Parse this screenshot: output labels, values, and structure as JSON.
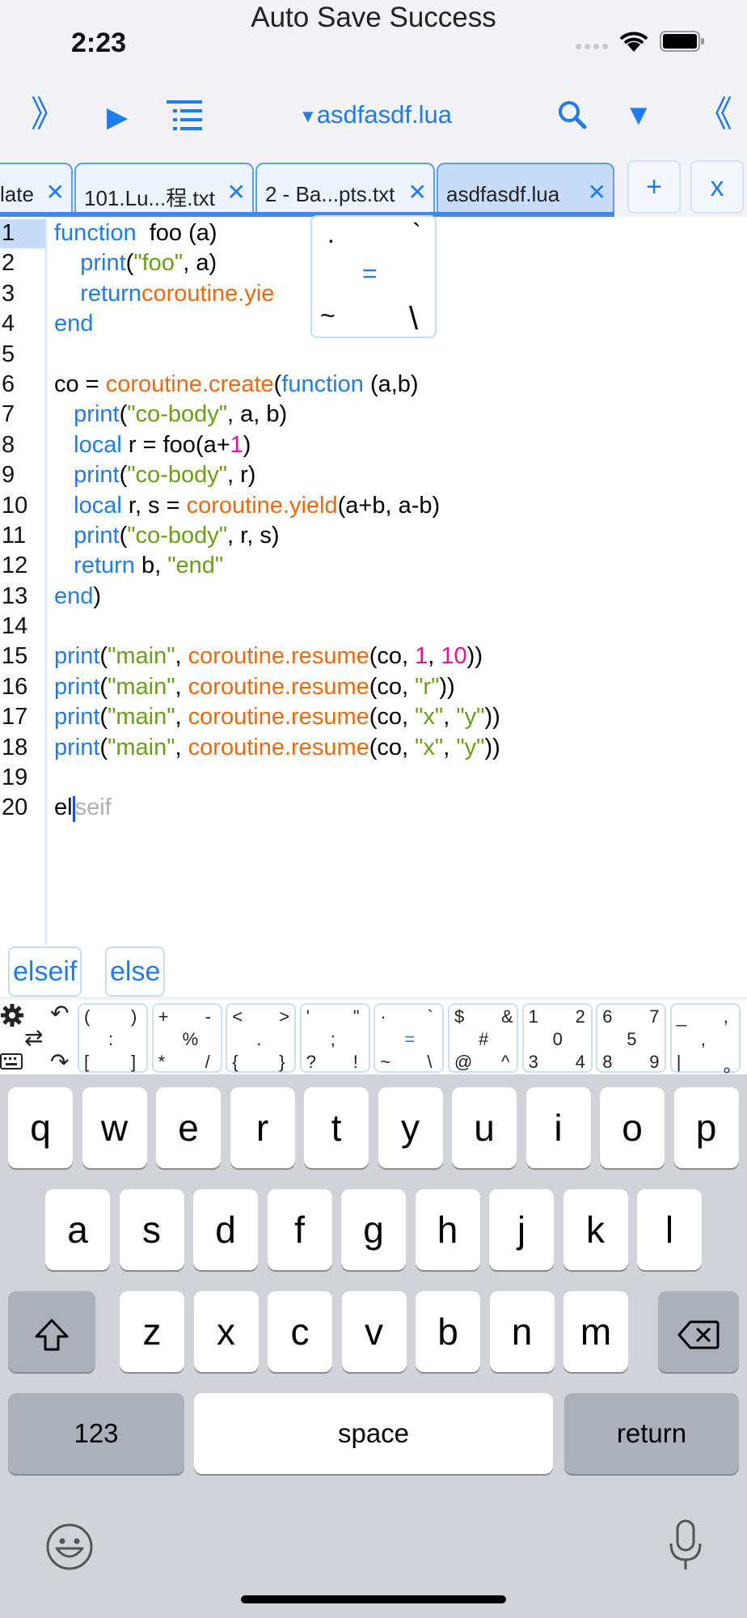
{
  "status": {
    "notice": "Auto Save Success",
    "time": "2:23"
  },
  "toolbar": {
    "left_expand": "》",
    "run": "▶",
    "list_icon": "list-icon",
    "file_title": "asdfasdf.lua",
    "search_icon": "search-icon",
    "filter": "▼",
    "right_collapse": "《"
  },
  "tabs": [
    {
      "label": "late",
      "close": "✕"
    },
    {
      "label": "101.Lu...程.txt",
      "close": "✕"
    },
    {
      "label": "2 - Ba...pts.txt",
      "close": "✕"
    },
    {
      "label": "asdfasdf.lua",
      "close": "✕",
      "active": true
    }
  ],
  "tab_actions": {
    "add": "+",
    "close": "x"
  },
  "editor": {
    "lines": [
      {
        "n": "1",
        "tokens": [
          [
            "kw",
            "function"
          ],
          [
            "",
            "  foo (a)"
          ]
        ]
      },
      {
        "n": "2",
        "tokens": [
          [
            "",
            "    "
          ],
          [
            "kw",
            "print"
          ],
          [
            "",
            "("
          ],
          [
            "str",
            "\"foo\""
          ],
          [
            "",
            ", a)"
          ]
        ]
      },
      {
        "n": "3",
        "tokens": [
          [
            "",
            "    "
          ],
          [
            "kw",
            "return"
          ],
          [
            "",
            ""
          ],
          [
            "fn",
            "coroutine.yie"
          ]
        ]
      },
      {
        "n": "4",
        "tokens": [
          [
            "kw",
            "end"
          ]
        ]
      },
      {
        "n": "5",
        "tokens": []
      },
      {
        "n": "6",
        "tokens": [
          [
            "",
            "co = "
          ],
          [
            "fn",
            "coroutine.create"
          ],
          [
            "",
            "("
          ],
          [
            "kw",
            "function"
          ],
          [
            "",
            " (a,b)"
          ]
        ]
      },
      {
        "n": "7",
        "tokens": [
          [
            "",
            "   "
          ],
          [
            "kw",
            "print"
          ],
          [
            "",
            "("
          ],
          [
            "str",
            "\"co-body\""
          ],
          [
            "",
            ", a, b)"
          ]
        ]
      },
      {
        "n": "8",
        "tokens": [
          [
            "",
            "   "
          ],
          [
            "kw",
            "local"
          ],
          [
            "",
            " r = foo(a+"
          ],
          [
            "num",
            "1"
          ],
          [
            "",
            ")"
          ]
        ]
      },
      {
        "n": "9",
        "tokens": [
          [
            "",
            "   "
          ],
          [
            "kw",
            "print"
          ],
          [
            "",
            "("
          ],
          [
            "str",
            "\"co-body\""
          ],
          [
            "",
            ", r)"
          ]
        ]
      },
      {
        "n": "10",
        "tokens": [
          [
            "",
            "   "
          ],
          [
            "kw",
            "local"
          ],
          [
            "",
            " r, s = "
          ],
          [
            "fn",
            "coroutine.yield"
          ],
          [
            "",
            "(a+b, a-b)"
          ]
        ]
      },
      {
        "n": "11",
        "tokens": [
          [
            "",
            "   "
          ],
          [
            "kw",
            "print"
          ],
          [
            "",
            "("
          ],
          [
            "str",
            "\"co-body\""
          ],
          [
            "",
            ", r, s)"
          ]
        ]
      },
      {
        "n": "12",
        "tokens": [
          [
            "",
            "   "
          ],
          [
            "kw",
            "return"
          ],
          [
            "",
            " b, "
          ],
          [
            "str",
            "\"end\""
          ]
        ]
      },
      {
        "n": "13",
        "tokens": [
          [
            "kw",
            "end"
          ],
          [
            "",
            ")"
          ]
        ]
      },
      {
        "n": "14",
        "tokens": []
      },
      {
        "n": "15",
        "tokens": [
          [
            "kw",
            "print"
          ],
          [
            "",
            "("
          ],
          [
            "str",
            "\"main\""
          ],
          [
            "",
            ", "
          ],
          [
            "fn",
            "coroutine.resume"
          ],
          [
            "",
            "(co, "
          ],
          [
            "num",
            "1"
          ],
          [
            "",
            ", "
          ],
          [
            "num",
            "10"
          ],
          [
            "",
            "))"
          ]
        ]
      },
      {
        "n": "16",
        "tokens": [
          [
            "kw",
            "print"
          ],
          [
            "",
            "("
          ],
          [
            "str",
            "\"main\""
          ],
          [
            "",
            ", "
          ],
          [
            "fn",
            "coroutine.resume"
          ],
          [
            "",
            "(co, "
          ],
          [
            "str",
            "\"r\""
          ],
          [
            "",
            "))"
          ]
        ]
      },
      {
        "n": "17",
        "tokens": [
          [
            "kw",
            "print"
          ],
          [
            "",
            "("
          ],
          [
            "str",
            "\"main\""
          ],
          [
            "",
            ", "
          ],
          [
            "fn",
            "coroutine.resume"
          ],
          [
            "",
            "(co, "
          ],
          [
            "str",
            "\"x\""
          ],
          [
            "",
            ", "
          ],
          [
            "str",
            "\"y\""
          ],
          [
            "",
            "))"
          ]
        ]
      },
      {
        "n": "18",
        "tokens": [
          [
            "kw",
            "print"
          ],
          [
            "",
            "("
          ],
          [
            "str",
            "\"main\""
          ],
          [
            "",
            ", "
          ],
          [
            "fn",
            "coroutine.resume"
          ],
          [
            "",
            "(co, "
          ],
          [
            "str",
            "\"x\""
          ],
          [
            "",
            ", "
          ],
          [
            "str",
            "\"y\""
          ],
          [
            "",
            "))"
          ]
        ]
      },
      {
        "n": "19",
        "tokens": []
      },
      {
        "n": "20",
        "tokens": [
          [
            "",
            "el"
          ],
          [
            "cursor",
            ""
          ],
          [
            "ghost",
            "seif"
          ]
        ]
      }
    ]
  },
  "popup": {
    "tl": "·",
    "tr": "`",
    "center": "=",
    "bl": "~",
    "br": "\\"
  },
  "suggestions": [
    "elseif",
    "else"
  ],
  "symbol_keys": [
    {
      "tl": "(",
      "tr": ")",
      "c": ":",
      "bl": "[",
      "br": "]"
    },
    {
      "tl": "+",
      "tr": "-",
      "c": "%",
      "bl": "*",
      "br": "/"
    },
    {
      "tl": "<",
      "tr": ">",
      "c": ".",
      "bl": "{",
      "br": "}"
    },
    {
      "tl": "'",
      "tr": "\"",
      "c": ";",
      "bl": "?",
      "br": "!"
    },
    {
      "tl": "·",
      "tr": "`",
      "c": "=",
      "bl": "~",
      "br": "\\"
    },
    {
      "tl": "$",
      "tr": "&",
      "c": "#",
      "bl": "@",
      "br": "^"
    },
    {
      "tl": "1",
      "tr": "2",
      "c": "0",
      "bl": "3",
      "br": "4"
    },
    {
      "tl": "6",
      "tr": "7",
      "c": "5",
      "bl": "8",
      "br": "9"
    },
    {
      "tl": "_",
      "tr": ",",
      "c": ",",
      "bl": "|",
      "br": "。"
    }
  ],
  "keyboard": {
    "row1": [
      "q",
      "w",
      "e",
      "r",
      "t",
      "y",
      "u",
      "i",
      "o",
      "p"
    ],
    "row2": [
      "a",
      "s",
      "d",
      "f",
      "g",
      "h",
      "j",
      "k",
      "l"
    ],
    "row3": [
      "z",
      "x",
      "c",
      "v",
      "b",
      "n",
      "m"
    ],
    "numbers": "123",
    "space": "space",
    "return": "return"
  },
  "colors": {
    "accent": "#1e7cf0",
    "function": "#f2670a",
    "string": "#6a9e15",
    "number": "#e0158f"
  }
}
